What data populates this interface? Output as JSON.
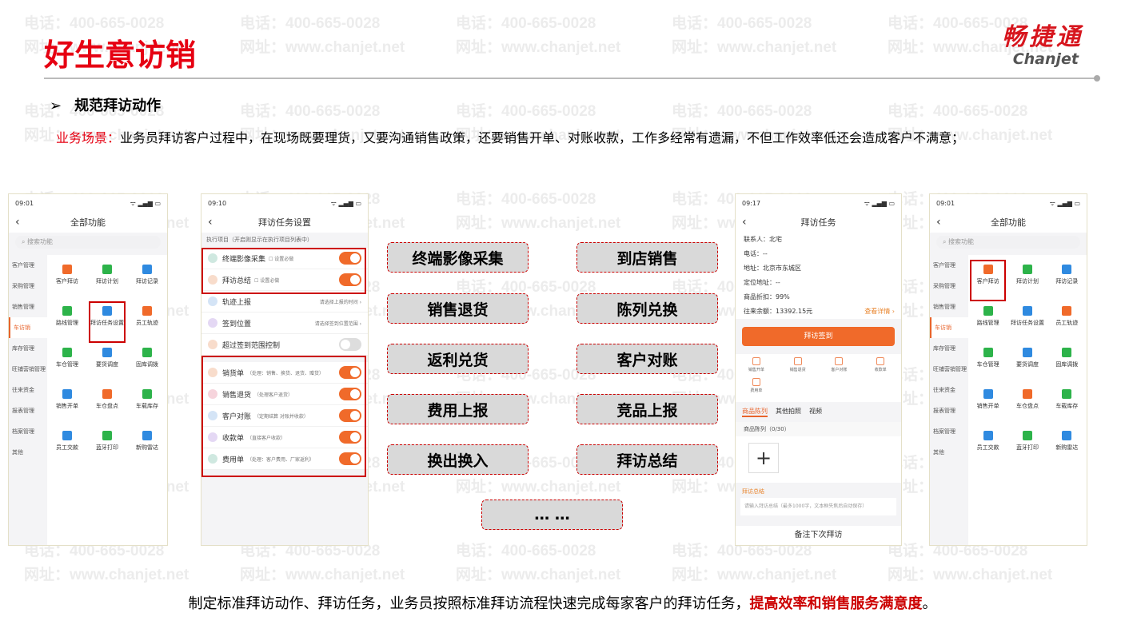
{
  "watermark": {
    "phone": "电话：400-665-0028",
    "site": "网址：www.chanjet.net"
  },
  "header": {
    "title": "好生意访销",
    "logo_cn": "畅捷通",
    "logo_en": "Chanjet"
  },
  "section": {
    "bullet": "➢",
    "heading": "规范拜访动作"
  },
  "scenario": {
    "label": "业务场景：",
    "text": "业务员拜访客户过程中，在现场既要理货，又要沟通销售政策，还要销售开单、对账收款，工作多经常有遗漏，不但工作效率低还会造成客户不满意；"
  },
  "colors": {
    "accent": "#e60012",
    "orange": "#f06a2a"
  },
  "phone_all_functions": {
    "time1": "09:01",
    "time4": "09:01",
    "title": "全部功能",
    "search_placeholder": "搜索功能",
    "sidebar": [
      "客户管理",
      "采购管理",
      "销售管理",
      "车访销",
      "库存管理",
      "旺铺营销管理",
      "往来资金",
      "报表管理",
      "档案管理",
      "其他"
    ],
    "active_sidebar": "车访销",
    "items": [
      {
        "label": "客户拜访",
        "color": "#f06a2a"
      },
      {
        "label": "拜访计划",
        "color": "#2db34a"
      },
      {
        "label": "拜访记录",
        "color": "#2f8ae0"
      },
      {
        "label": "路线管理",
        "color": "#2db34a"
      },
      {
        "label": "拜访任务设置",
        "color": "#2f8ae0"
      },
      {
        "label": "员工轨迹",
        "color": "#f06a2a"
      },
      {
        "label": "车仓管理",
        "color": "#2db34a"
      },
      {
        "label": "要货调度",
        "color": "#2f8ae0"
      },
      {
        "label": "固库调拨",
        "color": "#2db34a"
      },
      {
        "label": "销售开单",
        "color": "#2f8ae0"
      },
      {
        "label": "车仓盘点",
        "color": "#f06a2a"
      },
      {
        "label": "车载库存",
        "color": "#2db34a"
      },
      {
        "label": "员工交款",
        "color": "#2f8ae0"
      },
      {
        "label": "蓝牙打印",
        "color": "#2db34a"
      },
      {
        "label": "新购雷达",
        "color": "#2f8ae0"
      }
    ]
  },
  "phone_task_settings": {
    "time": "09:10",
    "title": "拜访任务设置",
    "section_label": "执行项目（开启则显示在执行项目列表中）",
    "rows": [
      {
        "label": "终端影像采集",
        "check": "设置必做",
        "toggle": true,
        "color": "#cfe8e0"
      },
      {
        "label": "拜访总结",
        "check": "设置必做",
        "toggle": true,
        "color": "#f8dccb"
      },
      {
        "label": "轨迹上报",
        "right": "请选择上报的时间 ›",
        "color": "#d4e4f6"
      },
      {
        "label": "签到位置",
        "right": "请选择签到位置范围 ›",
        "color": "#e4d8f4"
      },
      {
        "label": "超过签到范围控制",
        "toggle": false,
        "color": "#f8dccb"
      },
      {
        "label": "销货单",
        "sub": "（处理：销售、换货、退货、赠货）",
        "toggle": true,
        "color": "#f8dccb"
      },
      {
        "label": "销售退货",
        "sub": "（处理客户退货）",
        "toggle": true,
        "color": "#f6d4dc"
      },
      {
        "label": "客户对账",
        "sub": "（定期结算 对账并收款）",
        "toggle": true,
        "color": "#d4e4f6"
      },
      {
        "label": "收款单",
        "sub": "（直接客户收款）",
        "toggle": true,
        "color": "#e4d8f4"
      },
      {
        "label": "费用单",
        "sub": "（处理：客户费用、厂家返利）",
        "toggle": true,
        "color": "#cfe8e0"
      }
    ]
  },
  "actions": [
    "终端影像采集",
    "到店销售",
    "销售退货",
    "陈列兑换",
    "返利兑货",
    "客户对账",
    "费用上报",
    "竞品上报",
    "换出换入",
    "拜访总结",
    "… …"
  ],
  "phone_visit_task": {
    "time": "09:17",
    "title": "拜访任务",
    "info": [
      "联系人：北宅",
      "电话：--",
      "地址：北京市东城区",
      "定位地址：--",
      "商品折扣：99%",
      "往来余额：13392.15元"
    ],
    "detail_link": "查看详情 ›",
    "checkin_button": "拜访签到",
    "quick": [
      "销售开单",
      "销售退货",
      "客户对账",
      "收款单",
      "费用单"
    ],
    "tabs": [
      "商品陈列",
      "其他拍照",
      "视频"
    ],
    "display_label": "商品陈列（0/30）",
    "add": "+",
    "summary_label": "拜访总结",
    "summary_placeholder": "请输入拜访总结（最多1000字，文本框失焦后自动保存）",
    "bottom": "备注下次拜访"
  },
  "footer": {
    "text": "制定标准拜访动作、拜访任务，业务员按照标准拜访流程快速完成每家客户的拜访任务，",
    "emphasis": "提高效率和销售服务满意度",
    "end": "。"
  }
}
